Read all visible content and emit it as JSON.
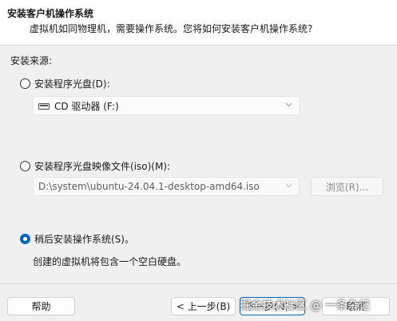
{
  "header": {
    "title": "安装客户机操作系统",
    "subtitle": "虚拟机如同物理机，需要操作系统。您将如何安装客户机操作系统?"
  },
  "source": {
    "label": "安装来源:",
    "options": [
      {
        "label": "安装程序光盘(D):",
        "checked": false
      },
      {
        "label": "安装程序光盘映像文件(iso)(M):",
        "checked": false
      },
      {
        "label": "稍后安装操作系统(S)。",
        "checked": true
      }
    ],
    "drive_combo_value": "CD 驱动器 (F:)",
    "iso_combo_value": "D:\\system\\ubuntu-24.04.1-desktop-amd64.iso",
    "browse_label": "浏览(R)...",
    "later_description": "创建的虚拟机将包含一个空白硬盘。"
  },
  "footer": {
    "help_label": "帮助",
    "back_label": "< 上一步(B)",
    "next_label": "下一步(N) >",
    "cancel_label": "取消"
  },
  "watermark": "掘金技术社区 @ 一条杂记",
  "colors": {
    "accent": "#0067c0",
    "background": "#f0f0f0"
  }
}
